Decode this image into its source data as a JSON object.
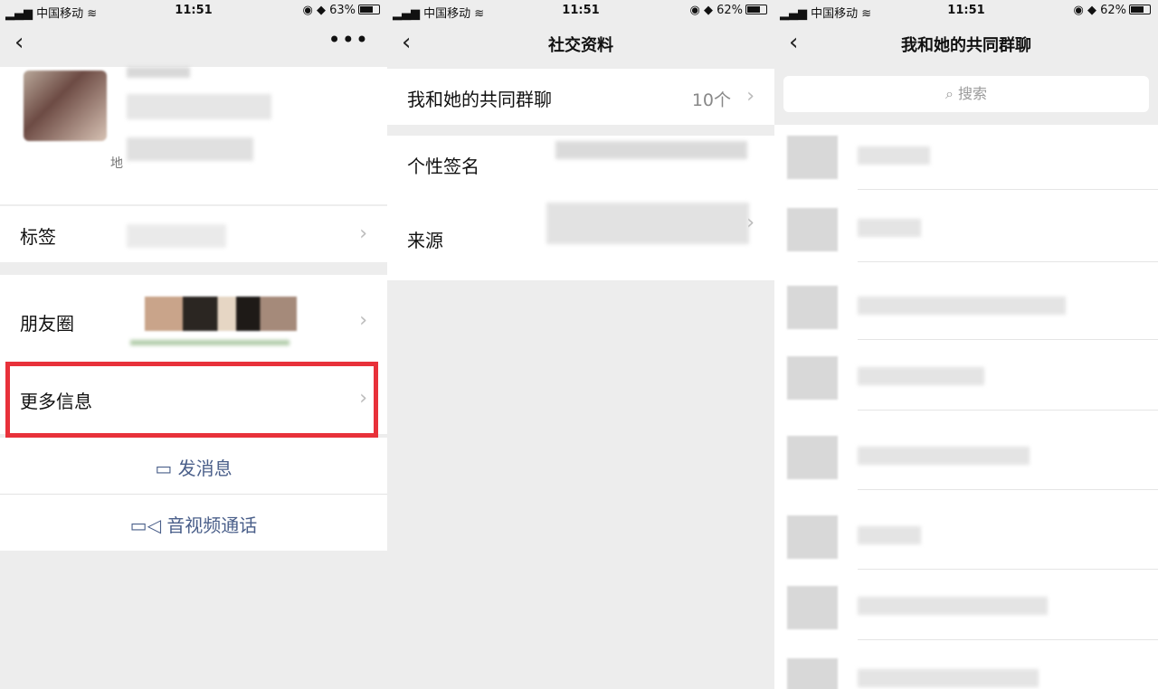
{
  "status_bars": [
    {
      "carrier": "中国移动",
      "time": "11:51",
      "battery": "63%",
      "battery_level": 0.63
    },
    {
      "carrier": "中国移动",
      "time": "11:51",
      "battery": "62%",
      "battery_level": 0.62
    },
    {
      "carrier": "中国移动",
      "time": "11:51",
      "battery": "62%",
      "battery_level": 0.62
    }
  ],
  "panel1": {
    "profile_partial_text": "地",
    "rows": {
      "tags": "标签",
      "moments": "朋友圈",
      "more_info": "更多信息"
    },
    "actions": {
      "send_message": "发消息",
      "av_call": "音视频通话"
    }
  },
  "panel2": {
    "title": "社交资料",
    "rows": {
      "common_groups": "我和她的共同群聊",
      "common_groups_count": "10个",
      "signature": "个性签名",
      "source": "来源"
    }
  },
  "panel3": {
    "title": "我和她的共同群聊",
    "search_placeholder": "搜索"
  },
  "icons": {
    "back": "chevron-left-icon",
    "more": "ellipsis-icon",
    "chevron": "chevron-right-icon",
    "chat": "chat-bubble-icon",
    "video": "video-camera-icon",
    "search": "search-icon"
  },
  "colors": {
    "highlight_box": "#e8313a",
    "action_text": "#4a5f8a"
  }
}
